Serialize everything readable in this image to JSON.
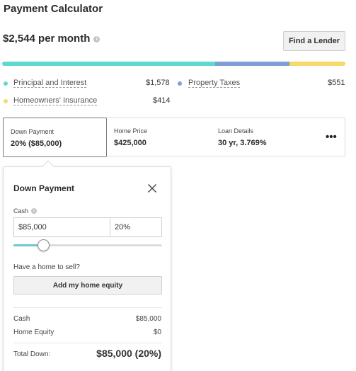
{
  "header": {
    "title": "Payment Calculator",
    "monthly_payment": "$2,544 per month",
    "info_icon": "info-icon",
    "find_lender_label": "Find a Lender"
  },
  "breakdown": {
    "segments": [
      {
        "name": "Principal and Interest",
        "value": "$1,578",
        "amount": 1578,
        "color": "#5fd8cf"
      },
      {
        "name": "Property Taxes",
        "value": "$551",
        "amount": 551,
        "color": "#7d9fd3"
      },
      {
        "name": "Homeowners' Insurance",
        "value": "$414",
        "amount": 414,
        "color": "#f7d86b"
      }
    ]
  },
  "tabs": [
    {
      "label": "Down Payment",
      "value": "20% ($85,000)"
    },
    {
      "label": "Home Price",
      "value": "$425,000"
    },
    {
      "label": "Loan Details",
      "value": "30 yr, 3.769%"
    }
  ],
  "more_label": "•••",
  "down_payment_panel": {
    "title": "Down Payment",
    "cash_label": "Cash",
    "cash_amount": "$85,000",
    "cash_percent": "20%",
    "slider_fraction": 0.2,
    "sell_question": "Have a home to sell?",
    "equity_button_label": "Add my home equity",
    "summary": {
      "cash_label": "Cash",
      "cash_value": "$85,000",
      "equity_label": "Home Equity",
      "equity_value": "$0",
      "total_label": "Total Down:",
      "total_value": "$85,000 (20%)"
    }
  }
}
